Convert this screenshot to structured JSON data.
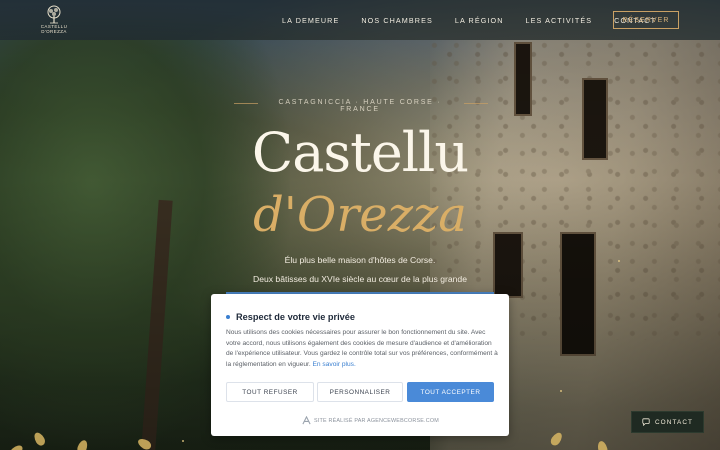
{
  "header": {
    "logo_text": "CASTELLU D'OREZZA",
    "nav": [
      {
        "label": "LA DEMEURE"
      },
      {
        "label": "NOS CHAMBRES"
      },
      {
        "label": "LA RÉGION"
      },
      {
        "label": "LES ACTIVITÉS"
      },
      {
        "label": "CONTACT"
      }
    ],
    "reserve_label": "RÉSERVER"
  },
  "hero": {
    "tagline": "CASTAGNICCIA · HAUTE CORSE · FRANCE",
    "title_line1": "Castellu",
    "title_line2": "d'Orezza",
    "subtitle_line1": "Élu plus belle maison d'hôtes de Corse.",
    "subtitle_line2": "Deux bâtisses du XVIe siècle au cœur de la plus grande"
  },
  "cookie_banner": {
    "title": "Respect de votre vie privée",
    "body": "Nous utilisons des cookies nécessaires pour assurer le bon fonctionnement du site. Avec votre accord, nous utilisons également des cookies de mesure d'audience et d'amélioration de l'expérience utilisateur. Vous gardez le contrôle total sur vos préférences, conformément à la réglementation en vigueur.",
    "link_text": "En savoir plus.",
    "refuse_label": "TOUT REFUSER",
    "personalize_label": "PERSONNALISER",
    "accept_label": "TOUT ACCEPTER",
    "credit": "SITE RÉALISÉ PAR AGENCEWEBCORSE.COM"
  },
  "floating_contact": {
    "label": "CONTACT"
  },
  "colors": {
    "accent_gold": "#d9ae66",
    "accept_blue": "#4a8ad8",
    "contact_bg": "#1f2a22"
  },
  "icons": {
    "logo": "tree-logo-icon",
    "credit": "agency-logo-icon",
    "contact": "chat-bubble-icon"
  }
}
